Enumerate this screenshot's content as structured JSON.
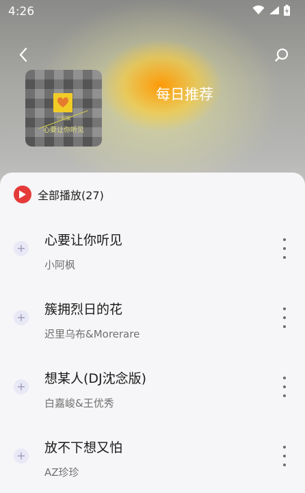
{
  "status_bar": {
    "time": "4:26",
    "icons": [
      "wifi-icon",
      "signal-icon",
      "battery-charging-icon"
    ]
  },
  "header": {
    "back_icon": "chevron-left-icon",
    "search_icon": "search-icon",
    "title": "每日推荐"
  },
  "cover": {
    "caption_small": "小阿枫",
    "caption": "心要让你听见",
    "icon": "heart-icon"
  },
  "play_all": {
    "icon": "play-circle-icon",
    "label": "全部播放(27)"
  },
  "songs": [
    {
      "title": "心要让你听见",
      "artist": "小阿枫"
    },
    {
      "title": "簇拥烈日的花",
      "artist": "迟里乌布&Morerare"
    },
    {
      "title": "想某人(DJ沈念版)",
      "artist": "白嘉峻&王优秀"
    },
    {
      "title": "放不下想又怕",
      "artist": "AZ珍珍"
    }
  ],
  "colors": {
    "accent": "#e53a3a",
    "sheet": "#f6f5f7",
    "title_text": "#ffffff"
  }
}
